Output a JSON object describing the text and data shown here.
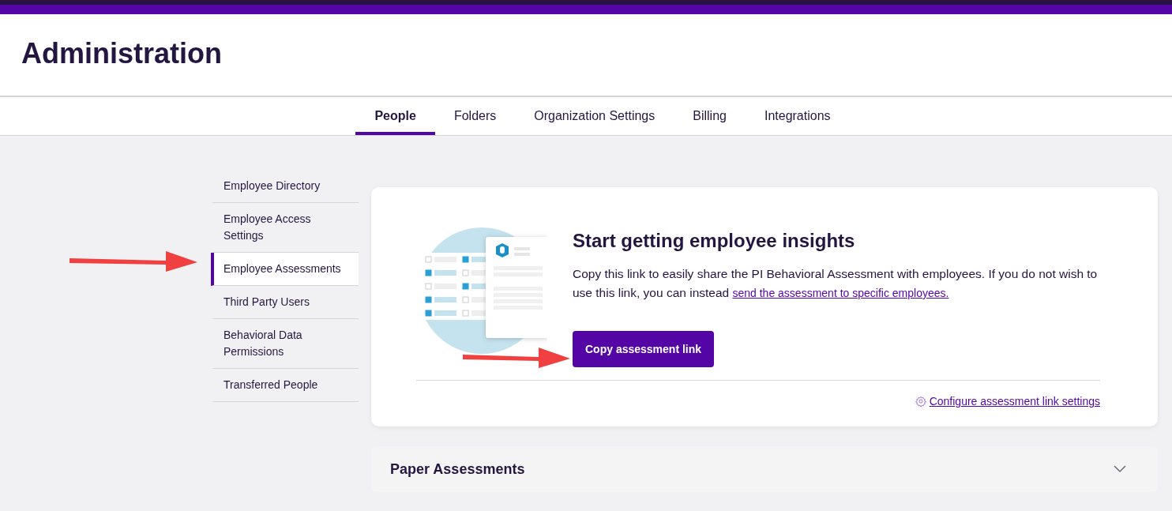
{
  "header": {
    "title": "Administration"
  },
  "tabs": [
    {
      "label": "People",
      "selected": true
    },
    {
      "label": "Folders",
      "selected": false
    },
    {
      "label": "Organization Settings",
      "selected": false
    },
    {
      "label": "Billing",
      "selected": false
    },
    {
      "label": "Integrations",
      "selected": false
    }
  ],
  "sidebar": {
    "items": [
      {
        "label": "Employee Directory",
        "selected": false
      },
      {
        "label": "Employee Access Settings",
        "selected": false
      },
      {
        "label": "Employee Assessments",
        "selected": true
      },
      {
        "label": "Third Party Users",
        "selected": false
      },
      {
        "label": "Behavioral Data Permissions",
        "selected": false
      },
      {
        "label": "Transferred People",
        "selected": false
      }
    ]
  },
  "insights_card": {
    "title": "Start getting employee insights",
    "description": "Copy this link to easily share the PI Behavioral Assessment with employees. If you do not wish to use this link, you can instead ",
    "description_link": "send the assessment to specific employees.",
    "button": "Copy assessment link",
    "settings_link": "Configure assessment link settings"
  },
  "paper_assessments": {
    "title": "Paper Assessments",
    "expanded": false
  }
}
